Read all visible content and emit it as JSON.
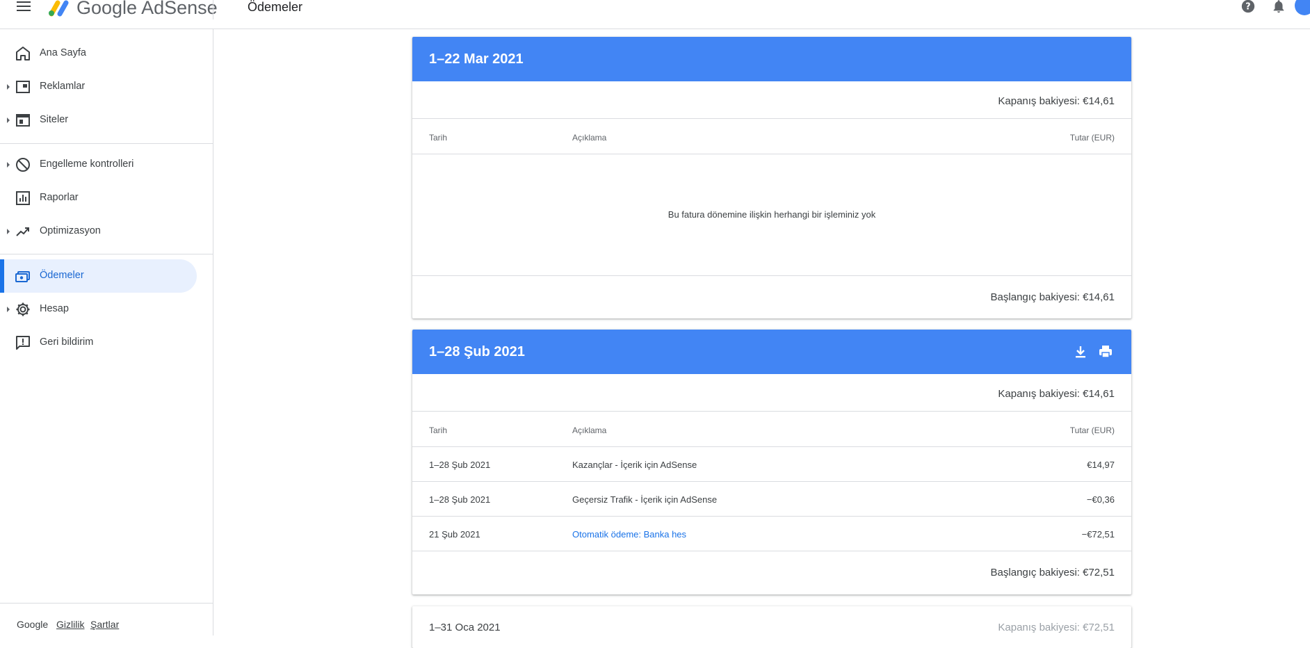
{
  "header": {
    "brand_google": "Google",
    "brand_product": "AdSense",
    "page_title": "Ödemeler",
    "icons": [
      "menu-icon",
      "help-icon",
      "notifications-icon"
    ]
  },
  "sidebar": {
    "items": [
      {
        "label": "Ana Sayfa",
        "icon": "home-icon"
      },
      {
        "label": "Reklamlar",
        "icon": "ads-icon"
      },
      {
        "label": "Siteler",
        "icon": "sites-icon"
      },
      {
        "label": "Engelleme kontrolleri",
        "icon": "block-icon"
      },
      {
        "label": "Raporlar",
        "icon": "reports-icon"
      },
      {
        "label": "Optimizasyon",
        "icon": "trending-up-icon"
      },
      {
        "label": "Ödemeler",
        "icon": "payments-icon",
        "active": true
      },
      {
        "label": "Hesap",
        "icon": "settings-icon"
      },
      {
        "label": "Geri bildirim",
        "icon": "feedback-icon"
      }
    ],
    "footer": {
      "google": "Google",
      "privacy": "Gizlilik",
      "terms": "Şartlar"
    }
  },
  "colors": {
    "header_blue": "#4285f4",
    "active_bg": "#e8f0fe",
    "active_accent": "#1a73e8",
    "link": "#1a73e8"
  },
  "columns": {
    "date": "Tarih",
    "desc": "Açıklama",
    "amount": "Tutar (EUR)"
  },
  "statements": [
    {
      "period": "1–22 Mar 2021",
      "closing": "Kapanış bakiyesi: €14,61",
      "empty_message": "Bu fatura dönemine ilişkin herhangi bir işleminiz yok",
      "opening": "Başlangıç bakiyesi: €14,61"
    },
    {
      "period": "1–28 Şub 2021",
      "closing": "Kapanış bakiyesi: €14,61",
      "rows": [
        {
          "date": "1–28 Şub 2021",
          "desc": "Kazançlar - İçerik için AdSense",
          "amount": "€14,97"
        },
        {
          "date": "1–28 Şub 2021",
          "desc": "Geçersiz Trafik - İçerik için AdSense",
          "amount": "−€0,36"
        },
        {
          "date": "21 Şub 2021",
          "desc": "Otomatik ödeme: Banka hes",
          "amount": "−€72,51"
        }
      ],
      "opening": "Başlangıç bakiyesi: €72,51"
    },
    {
      "period": "1–31 Oca 2021",
      "closing": "Kapanış bakiyesi: €72,51"
    }
  ]
}
